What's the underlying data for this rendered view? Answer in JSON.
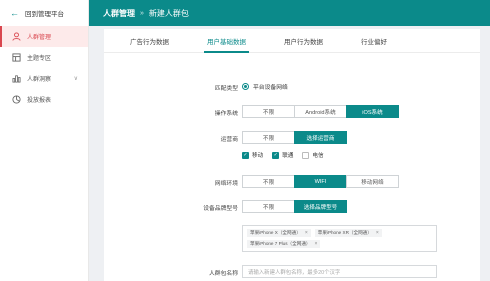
{
  "sidebar": {
    "header": "回到管理平台",
    "items": [
      {
        "label": "人群管理",
        "icon": "user-icon",
        "active": true
      },
      {
        "label": "主题专区",
        "icon": "grid-icon"
      },
      {
        "label": "人群洞察",
        "icon": "bar-chart-icon",
        "expandable": true
      },
      {
        "label": "投放报表",
        "icon": "pie-chart-icon"
      }
    ]
  },
  "topbar": {
    "crumb_main": "人群管理",
    "separator": "»",
    "crumb_current": "新建人群包",
    "color": "#0b8a8a"
  },
  "tabs": [
    "广告行为数据",
    "用户基础数据",
    "用户行为数据",
    "行业偏好"
  ],
  "form": {
    "match_type": {
      "label": "匹配类型",
      "option": "平台设备网络"
    },
    "os": {
      "label": "操作系统",
      "options": [
        "不限",
        "Android系统",
        "iOS系统"
      ],
      "selected": "iOS系统"
    },
    "carrier": {
      "label": "运营商",
      "options": [
        "不限",
        "选择运营商"
      ],
      "selected": "选择运营商",
      "checks": [
        {
          "label": "移动",
          "checked": true
        },
        {
          "label": "联通",
          "checked": true
        },
        {
          "label": "电信",
          "checked": false
        }
      ]
    },
    "network": {
      "label": "网络环境",
      "options": [
        "不限",
        "WIFI",
        "移动网络"
      ],
      "selected": "WIFI"
    },
    "device": {
      "label": "设备品牌型号",
      "options": [
        "不限",
        "选择品牌型号"
      ],
      "selected": "选择品牌型号",
      "tags": [
        "苹果iPhone X（全网通）",
        "苹果iPhone XR（全网通）",
        "苹果iPhone 7 Plus（全网通）"
      ],
      "tag_close": "×"
    },
    "pack_name": {
      "label": "人群包名称",
      "placeholder": "请输入新建人群包名称，最多20个汉字"
    }
  },
  "accent_color": "#0b8a8a",
  "active_color": "#d9474f"
}
